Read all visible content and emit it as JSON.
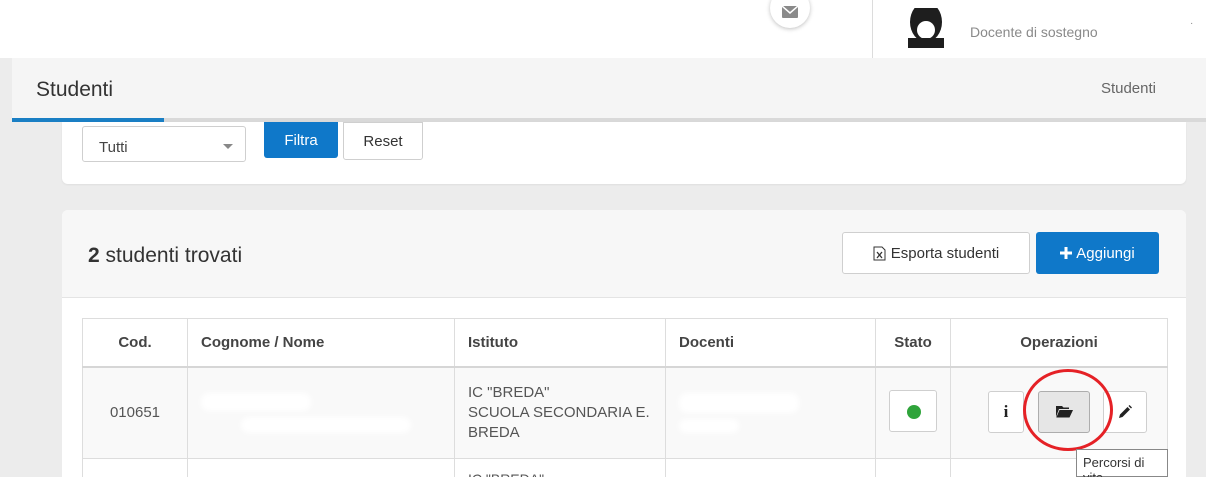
{
  "header": {
    "user_role": "Docente di sostegno",
    "mail_icon": "envelope-icon",
    "avatar_icon": "user-avatar-icon"
  },
  "page": {
    "title": "Studenti",
    "breadcrumb": "Studenti"
  },
  "filters": {
    "select_value": "Tutti",
    "filter_label": "Filtra",
    "reset_label": "Reset"
  },
  "results": {
    "count": "2",
    "count_suffix": "studenti trovati",
    "export_label": "Esporta studenti",
    "add_label": "Aggiungi"
  },
  "table": {
    "headers": [
      "Cod.",
      "Cognome / Nome",
      "Istituto",
      "Docenti",
      "Stato",
      "Operazioni"
    ],
    "rows": [
      {
        "code": "010651",
        "istituto_line1": "IC \"BREDA\"",
        "istituto_line2": "SCUOLA SECONDARIA E.",
        "istituto_line3": "BREDA",
        "status": "active"
      },
      {
        "code": "",
        "istituto_line1": "IC \"BREDA\""
      }
    ]
  },
  "tooltip": {
    "text": "Percorsi di vita"
  },
  "colors": {
    "primary": "#0f78c9",
    "status_active": "#2fa43b",
    "highlight": "#e52126"
  }
}
